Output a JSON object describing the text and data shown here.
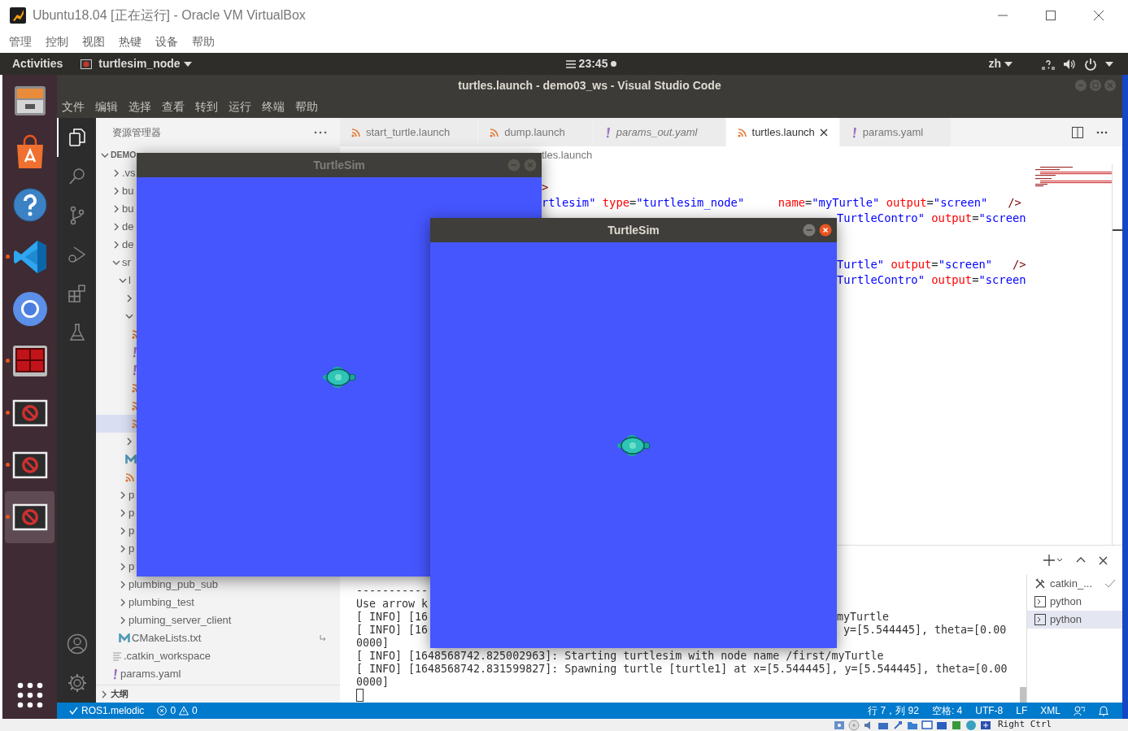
{
  "vbox": {
    "title": "Ubuntu18.04 [正在运行] - Oracle VM VirtualBox",
    "menu": [
      "管理",
      "控制",
      "视图",
      "热键",
      "设备",
      "帮助"
    ],
    "host_key": "Right Ctrl"
  },
  "topbar": {
    "activities": "Activities",
    "app": "turtlesim_node",
    "clock": "23:45",
    "input_method": "zh"
  },
  "dock": [
    {
      "kind": "files",
      "running": false,
      "selected": false
    },
    {
      "kind": "store",
      "running": false,
      "selected": false
    },
    {
      "kind": "help",
      "running": false,
      "selected": false
    },
    {
      "kind": "vscode",
      "running": true,
      "selected": false
    },
    {
      "kind": "chromium",
      "running": false,
      "selected": false
    },
    {
      "kind": "terminal",
      "running": true,
      "selected": false
    },
    {
      "kind": "blocked",
      "running": true,
      "selected": false
    },
    {
      "kind": "blocked",
      "running": true,
      "selected": false
    },
    {
      "kind": "blocked",
      "running": true,
      "selected": true
    }
  ],
  "vscode": {
    "title": "turtles.launch - demo03_ws - Visual Studio Code",
    "menu": [
      "文件",
      "编辑",
      "选择",
      "查看",
      "转到",
      "运行",
      "终端",
      "帮助"
    ]
  },
  "activity_bar": [
    {
      "kind": "explorer",
      "selected": true
    },
    {
      "kind": "search",
      "selected": false
    },
    {
      "kind": "scm",
      "selected": false
    },
    {
      "kind": "debug",
      "selected": false
    },
    {
      "kind": "extensions",
      "selected": false
    },
    {
      "kind": "test",
      "selected": false
    }
  ],
  "sidebar": {
    "title": "资源管理器",
    "outline": "大纲",
    "tree": [
      {
        "kind": "folder",
        "label": "DEMO",
        "expanded": true,
        "selected": false,
        "children": [
          {
            "kind": "folder",
            "label": ".vs",
            "expanded": false,
            "selected": false
          },
          {
            "kind": "folder",
            "label": "bu",
            "expanded": false,
            "selected": false
          },
          {
            "kind": "folder",
            "label": "bu",
            "expanded": false,
            "selected": false
          },
          {
            "kind": "folder",
            "label": "de",
            "expanded": false,
            "selected": false
          },
          {
            "kind": "folder",
            "label": "de",
            "expanded": false,
            "selected": false
          },
          {
            "kind": "folder",
            "label": "sr",
            "expanded": true,
            "selected": false,
            "children": [
              {
                "kind": "folder",
                "label": "l",
                "expanded": true,
                "selected": false,
                "children": [
                  {
                    "kind": "folder",
                    "expanded": false,
                    "selected": false
                  },
                  {
                    "kind": "folder",
                    "expanded": true,
                    "selected": false,
                    "children": [
                      {
                        "kind": "launch",
                        "selected": false
                      },
                      {
                        "kind": "yaml",
                        "selected": false
                      },
                      {
                        "kind": "yaml",
                        "selected": false
                      },
                      {
                        "kind": "launch",
                        "selected": false
                      },
                      {
                        "kind": "launch",
                        "selected": false
                      },
                      {
                        "kind": "launch",
                        "selected": true
                      }
                    ]
                  },
                  {
                    "kind": "folder",
                    "expanded": false,
                    "selected": false
                  },
                  {
                    "kind": "cmake",
                    "selected": false
                  },
                  {
                    "kind": "launch",
                    "selected": false
                  }
                ]
              },
              {
                "kind": "folder",
                "label": "p",
                "expanded": false,
                "selected": false
              },
              {
                "kind": "folder",
                "label": "p",
                "expanded": false,
                "selected": false
              },
              {
                "kind": "folder",
                "label": "p",
                "expanded": false,
                "selected": false
              },
              {
                "kind": "folder",
                "label": "p",
                "expanded": false,
                "selected": false
              },
              {
                "kind": "folder",
                "label": "p",
                "expanded": false,
                "selected": false
              },
              {
                "kind": "folder",
                "label": "plumbing_pub_sub",
                "expanded": false,
                "selected": false
              },
              {
                "kind": "folder",
                "label": "plumbing_test",
                "expanded": false,
                "selected": false
              },
              {
                "kind": "folder",
                "label": "pluming_server_client",
                "expanded": false,
                "selected": false
              },
              {
                "kind": "cmake",
                "label": "CMakeLists.txt",
                "selected": false,
                "decorated": true
              }
            ]
          },
          {
            "kind": "text",
            "label": ".catkin_workspace",
            "selected": false
          },
          {
            "kind": "yaml",
            "label": "params.yaml",
            "selected": false
          }
        ]
      }
    ]
  },
  "tabs": [
    {
      "kind": "launch",
      "label": "start_turtle.launch",
      "selected": false,
      "preview": false
    },
    {
      "kind": "launch",
      "label": "dump.launch",
      "selected": false,
      "preview": false
    },
    {
      "kind": "yaml",
      "label": "params_out.yaml",
      "selected": false,
      "preview": true
    },
    {
      "kind": "launch",
      "label": "turtles.launch",
      "selected": true,
      "preview": false
    },
    {
      "kind": "yaml",
      "label": "params.yaml",
      "selected": false,
      "preview": false
    }
  ],
  "breadcrumb": "tles.launch",
  "code": {
    "top_lines": [
      {
        "text": ">"
      },
      {
        "text": "rtlesim\" type=\"turtlesim_node\"     name=\"myTurtle\" output=\"screen\"   />"
      },
      {
        "tail": "TurtleContro\" output=\"screen"
      }
    ],
    "lower_lines": [
      {
        "tail": "Turtle\" output=\"screen\"   />"
      },
      {
        "tail": "TurtleContro\" output=\"screen"
      }
    ]
  },
  "terminal": {
    "lines": [
      {
        "text": "-----------"
      },
      {
        "text": "Use arrow k"
      },
      {
        "text": "[ INFO] [16",
        "tail": "myTurtle"
      },
      {
        "text": "[ INFO] [16",
        "tail": " y=[5.544445], theta=[0.00"
      },
      {
        "text": "0000]"
      },
      {
        "text": "[ INFO] [1648568742.825002963]: Starting turtlesim with node name /first/myTurtle"
      },
      {
        "text": "[ INFO] [1648568742.831599827]: Spawning turtle [turtle1] at x=[5.544445], y=[5.544445], theta=[0.00"
      },
      {
        "text": "0000]"
      }
    ],
    "cursor": true,
    "sessions": [
      {
        "kind": "task",
        "label": "catkin_...",
        "selected": false
      },
      {
        "kind": "shell",
        "label": "python",
        "selected": false
      },
      {
        "kind": "shell",
        "label": "python",
        "selected": true
      }
    ]
  },
  "status": {
    "remote": "ROS1.melodic",
    "errors": "0",
    "warnings": "0",
    "items": [
      "行 7，列 92",
      "空格: 4",
      "UTF-8",
      "LF",
      "XML"
    ]
  },
  "turtlesim": [
    {
      "title": "TurtleSim",
      "active": false
    },
    {
      "title": "TurtleSim",
      "active": true
    }
  ]
}
